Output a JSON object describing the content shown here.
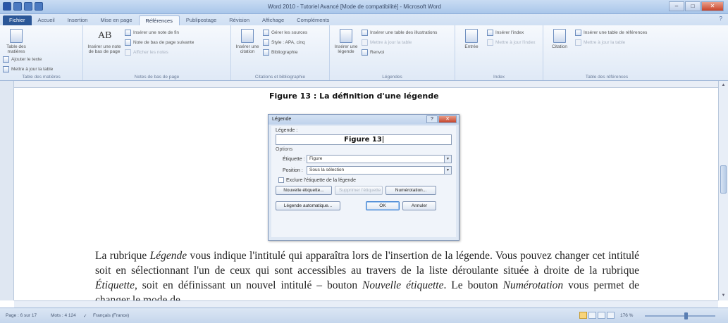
{
  "window": {
    "title": "Word 2010 - Tutoriel Avancé [Mode de compatibilité] - Microsoft Word",
    "controls": {
      "minimize": "–",
      "maximize": "□",
      "close": "✕"
    }
  },
  "tabs": [
    {
      "label": "Fichier"
    },
    {
      "label": "Accueil"
    },
    {
      "label": "Insertion"
    },
    {
      "label": "Mise en page"
    },
    {
      "label": "Références"
    },
    {
      "label": "Publipostage"
    },
    {
      "label": "Révision"
    },
    {
      "label": "Affichage"
    },
    {
      "label": "Compléments"
    }
  ],
  "ribbon": {
    "toc": {
      "big": "Table des matières",
      "small": [
        "Ajouter le texte",
        "Mettre à jour la table"
      ],
      "label": "Table des matières"
    },
    "footnotes": {
      "big": "Insérer une note de bas de page",
      "big_icon_text": "AB",
      "small": [
        "Insérer une note de fin",
        "Note de bas de page suivante",
        "Afficher les notes"
      ],
      "label": "Notes de bas de page"
    },
    "citations": {
      "big": "Insérer une citation",
      "small": [
        "Gérer les sources",
        "Style : APA, cinq",
        "Bibliographie"
      ],
      "label": "Citations et bibliographie"
    },
    "captions": {
      "big": "Insérer une légende",
      "small": [
        "Insérer une table des illustrations",
        "Mettre à jour la table",
        "Renvoi"
      ],
      "label": "Légendes"
    },
    "index": {
      "big": "Entrée",
      "small": [
        "Insérer l'index",
        "Mettre à jour l'index"
      ],
      "label": "Index"
    },
    "authorities": {
      "big": "Citation",
      "small": [
        "Insérer une table de références",
        "Mettre à jour la table"
      ],
      "label": "Table des références"
    }
  },
  "document": {
    "figure_caption": "Figure 13 : La définition d'une légende",
    "paragraph": {
      "p1": "La rubrique ",
      "i1": "Légende",
      "p2": " vous indique l'intitulé qui apparaîtra lors de l'insertion de la légende. Vous pouvez changer cet intitulé soit en sélectionnant l'un de ceux qui sont accessibles au travers de la liste déroulante située à droite de la rubrique ",
      "i2": "Étiquette",
      "p3": ", soit en définissant un nouvel intitulé – bouton ",
      "i3": "Nouvelle étiquette",
      "p4": ". Le bouton ",
      "i4": "Numérotation",
      "p5": " vous permet de changer le mode de"
    }
  },
  "dialog": {
    "title": "Légende",
    "legend_label": "Légende :",
    "legend_value": "Figure 13",
    "options_label": "Options",
    "etiquette_label": "Étiquette :",
    "etiquette_value": "Figure",
    "position_label": "Position :",
    "position_value": "Sous la sélection",
    "exclude_label": "Exclure l'étiquette de la légende",
    "exclude_checked": false,
    "btn_new_label": "Nouvelle étiquette...",
    "btn_delete_label": "Supprimer l'étiquette",
    "btn_numbering": "Numérotation...",
    "btn_auto": "Légende automatique...",
    "btn_ok": "OK",
    "btn_cancel": "Annuler"
  },
  "statusbar": {
    "page": "Page : 6 sur 17",
    "words": "Mots : 4 124",
    "language": "Français (France)",
    "zoom": "176 %"
  }
}
